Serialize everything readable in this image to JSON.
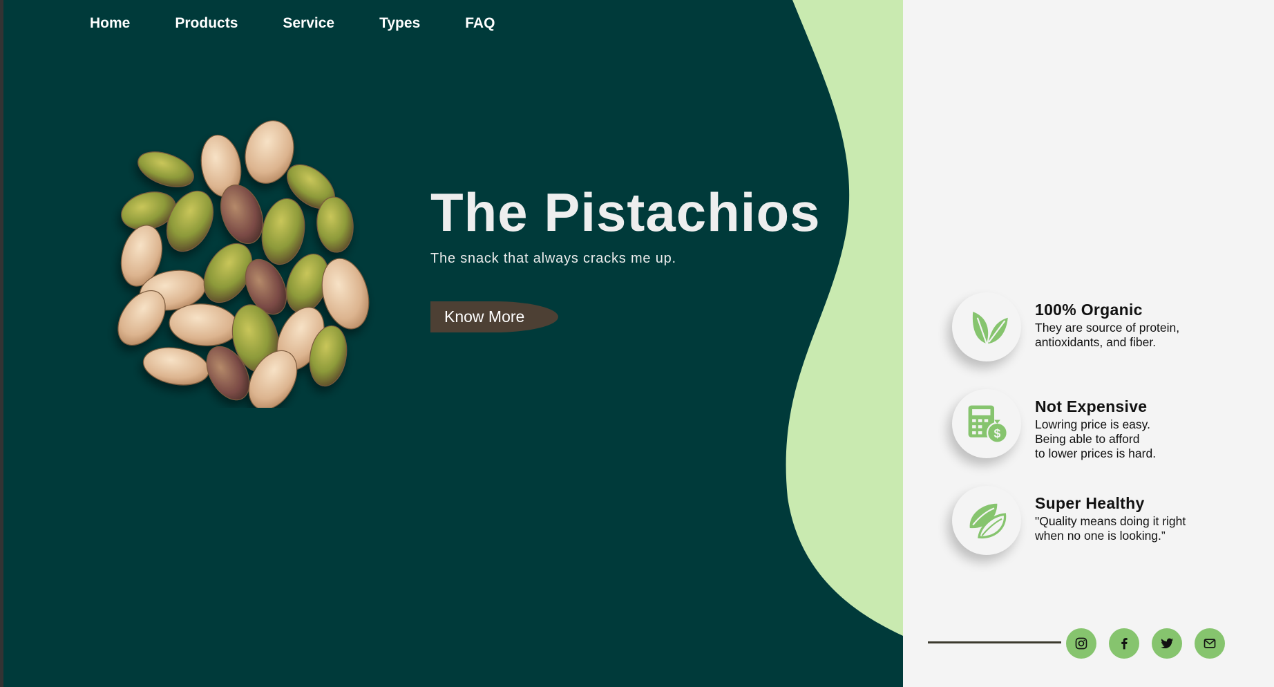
{
  "nav": {
    "items": [
      {
        "label": "Home"
      },
      {
        "label": "Products"
      },
      {
        "label": "Service"
      },
      {
        "label": "Types"
      },
      {
        "label": "FAQ"
      }
    ]
  },
  "hero": {
    "title": "The Pistachios",
    "subtitle": "The snack that always cracks me up.",
    "cta_label": "Know More",
    "image_icon": "pistachio-pile-image"
  },
  "features": [
    {
      "icon": "leaf-icon",
      "title": "100% Organic",
      "text": "They are source of protein,\nantioxidants, and fiber."
    },
    {
      "icon": "calculator-money-icon",
      "title": "Not Expensive",
      "text": "Lowring price is easy.\nBeing able to afford\nto lower prices is hard."
    },
    {
      "icon": "pistachio-icon",
      "title": "Super Healthy",
      "text": "\"Quality means doing it right\nwhen no one is looking.”"
    }
  ],
  "social": [
    {
      "icon": "instagram-icon"
    },
    {
      "icon": "facebook-icon"
    },
    {
      "icon": "twitter-icon"
    },
    {
      "icon": "mail-icon"
    }
  ],
  "colors": {
    "hero_bg": "#003a3a",
    "wave": "#c9eab0",
    "accent": "#86c46e",
    "button": "#4d4034",
    "right_bg": "#f4f4f4"
  }
}
